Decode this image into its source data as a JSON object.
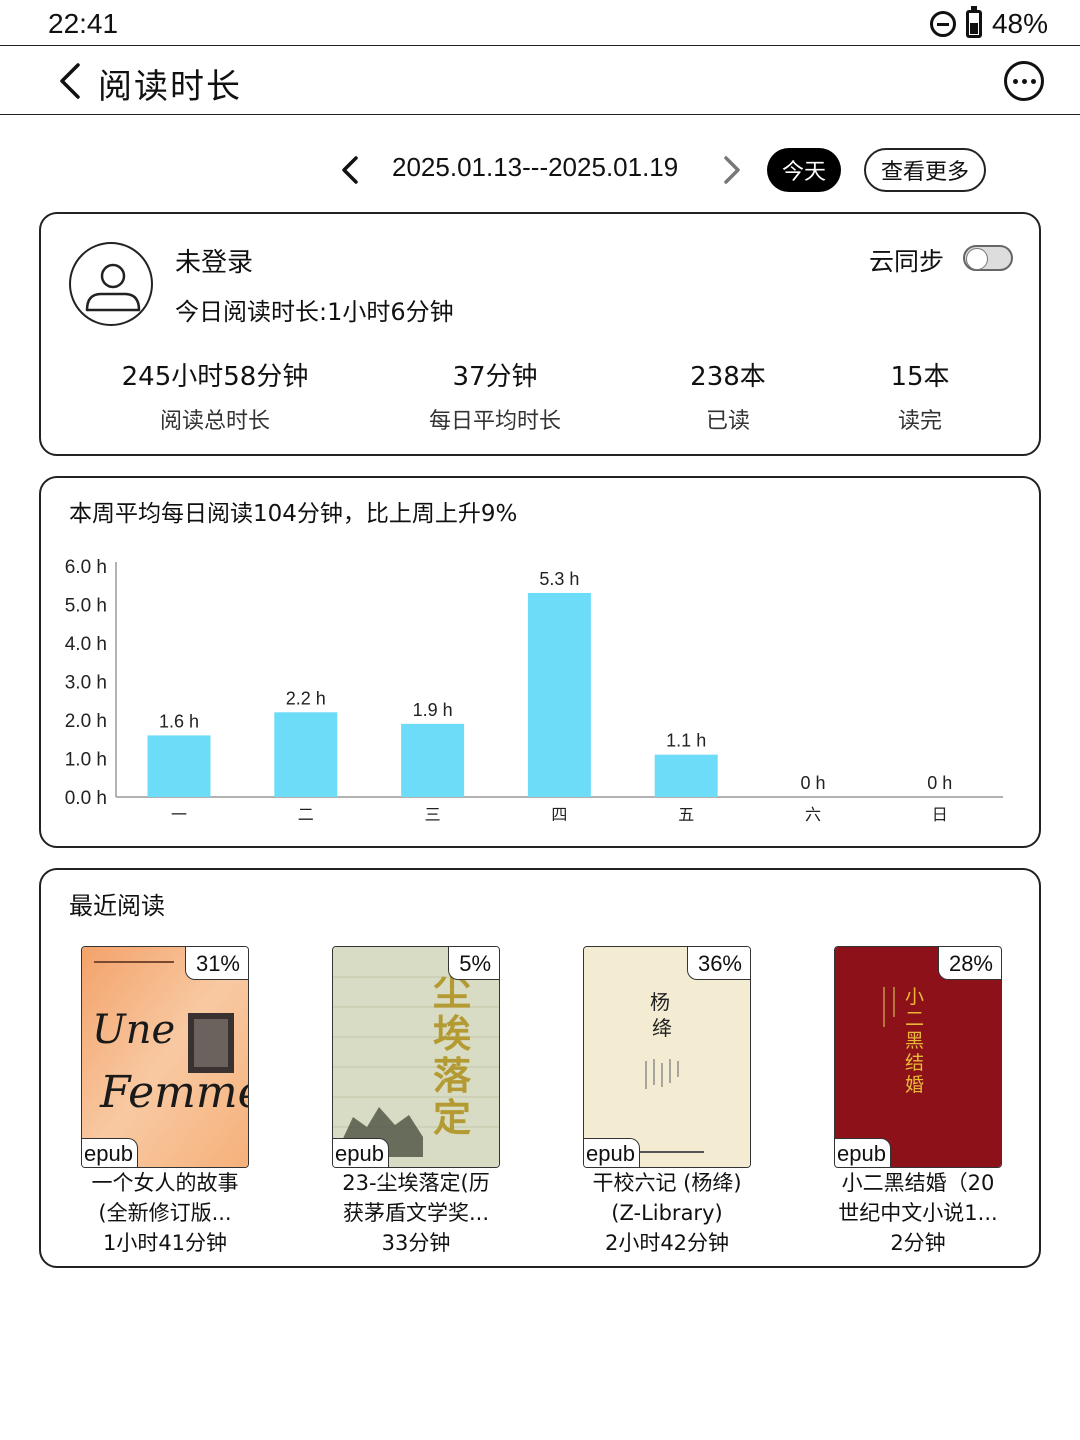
{
  "status": {
    "time": "22:41",
    "battery": "48%"
  },
  "header": {
    "title": "阅读时长"
  },
  "date_nav": {
    "range": "2025.01.13---2025.01.19",
    "today_label": "今天",
    "more_label": "查看更多"
  },
  "profile": {
    "username": "未登录",
    "today_reading": "今日阅读时长:1小时6分钟",
    "cloud_sync_label": "云同步",
    "cloud_sync_on": false,
    "stats": [
      {
        "value": "245小时58分钟",
        "label": "阅读总时长"
      },
      {
        "value": "37分钟",
        "label": "每日平均时长"
      },
      {
        "value": "238本",
        "label": "已读"
      },
      {
        "value": "15本",
        "label": "读完"
      }
    ]
  },
  "weekly": {
    "headline": "本周平均每日阅读104分钟，比上周上升9%"
  },
  "chart_data": {
    "type": "bar",
    "categories": [
      "一",
      "二",
      "三",
      "四",
      "五",
      "六",
      "日"
    ],
    "values": [
      1.6,
      2.2,
      1.9,
      5.3,
      1.1,
      0,
      0
    ],
    "value_labels": [
      "1.6 h",
      "2.2 h",
      "1.9 h",
      "5.3 h",
      "1.1 h",
      "0 h",
      "0 h"
    ],
    "yticks": [
      "0.0 h",
      "1.0 h",
      "2.0 h",
      "3.0 h",
      "4.0 h",
      "5.0 h",
      "6.0 h"
    ],
    "ylim": [
      0,
      6
    ],
    "bar_color": "#6ddcf9",
    "grid": false
  },
  "recent": {
    "title": "最近阅读",
    "books": [
      {
        "percent": "31%",
        "format": "epub",
        "title_line1": "一个女人的故事",
        "title_line2": "(全新修订版...",
        "time": "1小时41分钟",
        "cover_text": "Une Femme"
      },
      {
        "percent": "5%",
        "format": "epub",
        "title_line1": "23-尘埃落定(历",
        "title_line2": "获茅盾文学奖...",
        "time": "33分钟",
        "cover_text": "尘埃落定"
      },
      {
        "percent": "36%",
        "format": "epub",
        "title_line1": "干校六记 (杨绛)",
        "title_line2": "(Z-Library)",
        "time": "2小时42分钟",
        "cover_text": "杨绛"
      },
      {
        "percent": "28%",
        "format": "epub",
        "title_line1": "小二黑结婚（20",
        "title_line2": "世纪中文小说1...",
        "time": "2分钟",
        "cover_text": "小二黑结婚"
      }
    ]
  }
}
